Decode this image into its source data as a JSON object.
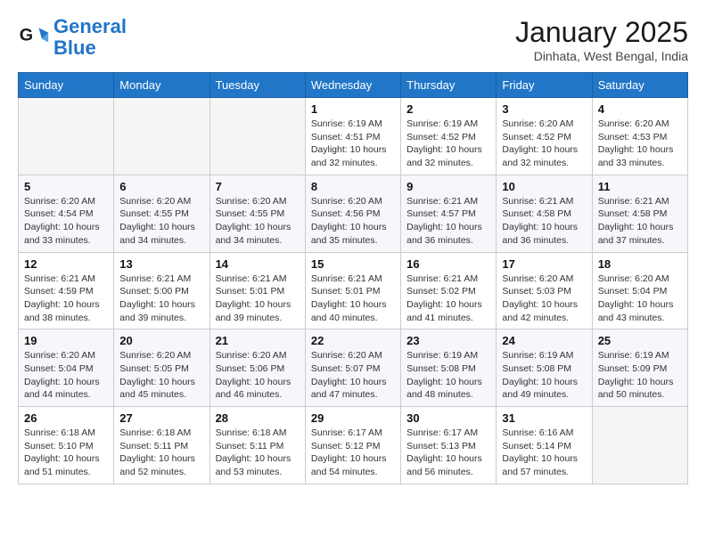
{
  "logo": {
    "line1": "General",
    "line2": "Blue"
  },
  "header": {
    "month": "January 2025",
    "location": "Dinhata, West Bengal, India"
  },
  "days_of_week": [
    "Sunday",
    "Monday",
    "Tuesday",
    "Wednesday",
    "Thursday",
    "Friday",
    "Saturday"
  ],
  "weeks": [
    [
      {
        "day": "",
        "info": ""
      },
      {
        "day": "",
        "info": ""
      },
      {
        "day": "",
        "info": ""
      },
      {
        "day": "1",
        "info": "Sunrise: 6:19 AM\nSunset: 4:51 PM\nDaylight: 10 hours\nand 32 minutes."
      },
      {
        "day": "2",
        "info": "Sunrise: 6:19 AM\nSunset: 4:52 PM\nDaylight: 10 hours\nand 32 minutes."
      },
      {
        "day": "3",
        "info": "Sunrise: 6:20 AM\nSunset: 4:52 PM\nDaylight: 10 hours\nand 32 minutes."
      },
      {
        "day": "4",
        "info": "Sunrise: 6:20 AM\nSunset: 4:53 PM\nDaylight: 10 hours\nand 33 minutes."
      }
    ],
    [
      {
        "day": "5",
        "info": "Sunrise: 6:20 AM\nSunset: 4:54 PM\nDaylight: 10 hours\nand 33 minutes."
      },
      {
        "day": "6",
        "info": "Sunrise: 6:20 AM\nSunset: 4:55 PM\nDaylight: 10 hours\nand 34 minutes."
      },
      {
        "day": "7",
        "info": "Sunrise: 6:20 AM\nSunset: 4:55 PM\nDaylight: 10 hours\nand 34 minutes."
      },
      {
        "day": "8",
        "info": "Sunrise: 6:20 AM\nSunset: 4:56 PM\nDaylight: 10 hours\nand 35 minutes."
      },
      {
        "day": "9",
        "info": "Sunrise: 6:21 AM\nSunset: 4:57 PM\nDaylight: 10 hours\nand 36 minutes."
      },
      {
        "day": "10",
        "info": "Sunrise: 6:21 AM\nSunset: 4:58 PM\nDaylight: 10 hours\nand 36 minutes."
      },
      {
        "day": "11",
        "info": "Sunrise: 6:21 AM\nSunset: 4:58 PM\nDaylight: 10 hours\nand 37 minutes."
      }
    ],
    [
      {
        "day": "12",
        "info": "Sunrise: 6:21 AM\nSunset: 4:59 PM\nDaylight: 10 hours\nand 38 minutes."
      },
      {
        "day": "13",
        "info": "Sunrise: 6:21 AM\nSunset: 5:00 PM\nDaylight: 10 hours\nand 39 minutes."
      },
      {
        "day": "14",
        "info": "Sunrise: 6:21 AM\nSunset: 5:01 PM\nDaylight: 10 hours\nand 39 minutes."
      },
      {
        "day": "15",
        "info": "Sunrise: 6:21 AM\nSunset: 5:01 PM\nDaylight: 10 hours\nand 40 minutes."
      },
      {
        "day": "16",
        "info": "Sunrise: 6:21 AM\nSunset: 5:02 PM\nDaylight: 10 hours\nand 41 minutes."
      },
      {
        "day": "17",
        "info": "Sunrise: 6:20 AM\nSunset: 5:03 PM\nDaylight: 10 hours\nand 42 minutes."
      },
      {
        "day": "18",
        "info": "Sunrise: 6:20 AM\nSunset: 5:04 PM\nDaylight: 10 hours\nand 43 minutes."
      }
    ],
    [
      {
        "day": "19",
        "info": "Sunrise: 6:20 AM\nSunset: 5:04 PM\nDaylight: 10 hours\nand 44 minutes."
      },
      {
        "day": "20",
        "info": "Sunrise: 6:20 AM\nSunset: 5:05 PM\nDaylight: 10 hours\nand 45 minutes."
      },
      {
        "day": "21",
        "info": "Sunrise: 6:20 AM\nSunset: 5:06 PM\nDaylight: 10 hours\nand 46 minutes."
      },
      {
        "day": "22",
        "info": "Sunrise: 6:20 AM\nSunset: 5:07 PM\nDaylight: 10 hours\nand 47 minutes."
      },
      {
        "day": "23",
        "info": "Sunrise: 6:19 AM\nSunset: 5:08 PM\nDaylight: 10 hours\nand 48 minutes."
      },
      {
        "day": "24",
        "info": "Sunrise: 6:19 AM\nSunset: 5:08 PM\nDaylight: 10 hours\nand 49 minutes."
      },
      {
        "day": "25",
        "info": "Sunrise: 6:19 AM\nSunset: 5:09 PM\nDaylight: 10 hours\nand 50 minutes."
      }
    ],
    [
      {
        "day": "26",
        "info": "Sunrise: 6:18 AM\nSunset: 5:10 PM\nDaylight: 10 hours\nand 51 minutes."
      },
      {
        "day": "27",
        "info": "Sunrise: 6:18 AM\nSunset: 5:11 PM\nDaylight: 10 hours\nand 52 minutes."
      },
      {
        "day": "28",
        "info": "Sunrise: 6:18 AM\nSunset: 5:11 PM\nDaylight: 10 hours\nand 53 minutes."
      },
      {
        "day": "29",
        "info": "Sunrise: 6:17 AM\nSunset: 5:12 PM\nDaylight: 10 hours\nand 54 minutes."
      },
      {
        "day": "30",
        "info": "Sunrise: 6:17 AM\nSunset: 5:13 PM\nDaylight: 10 hours\nand 56 minutes."
      },
      {
        "day": "31",
        "info": "Sunrise: 6:16 AM\nSunset: 5:14 PM\nDaylight: 10 hours\nand 57 minutes."
      },
      {
        "day": "",
        "info": ""
      }
    ]
  ]
}
